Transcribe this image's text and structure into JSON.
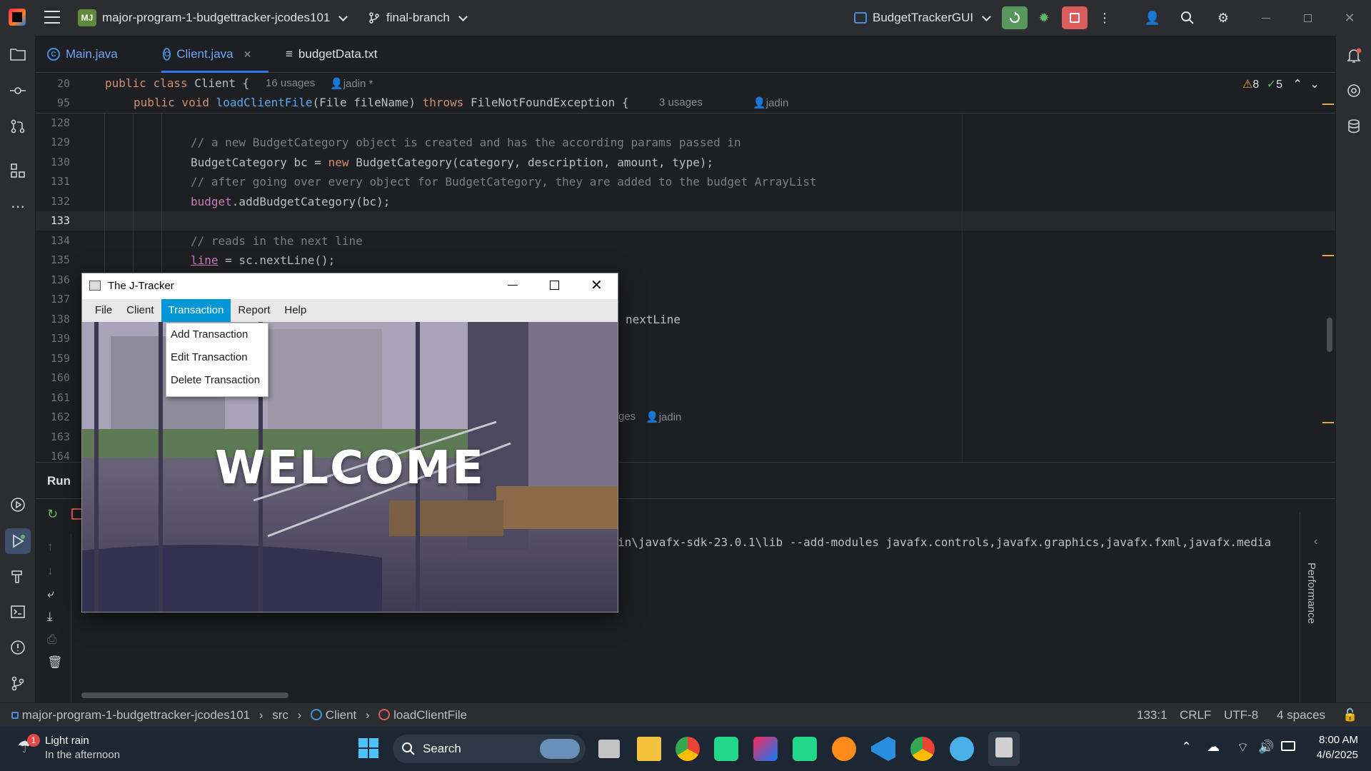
{
  "titlebar": {
    "project_badge": "MJ",
    "project_name": "major-program-1-budgettracker-jcodes101",
    "branch": "final-branch",
    "run_config": "BudgetTrackerGUI"
  },
  "tabs": [
    {
      "label": "Main.java"
    },
    {
      "label": "Client.java"
    },
    {
      "label": "budgetData.txt"
    }
  ],
  "editor": {
    "inspections": {
      "warnings": "8",
      "ok": "5"
    },
    "sticky": [
      {
        "line": "20",
        "pre": "public ",
        "kw2": "class ",
        "name": "Client {",
        "hint": "16 usages",
        "author": "jadin *"
      },
      {
        "line": "95",
        "sig_kw": "public void ",
        "sig_fn": "loadClientFile",
        "sig_args": "(File fileName) ",
        "sig_throws": "throws ",
        "sig_exc": "FileNotFoundException {",
        "hint": "3 usages",
        "author": "jadin"
      }
    ],
    "lines": [
      {
        "n": "128",
        "text": ""
      },
      {
        "n": "129",
        "text": "// a new BudgetCategory object is created and has the according params passed in"
      },
      {
        "n": "130",
        "text": "BudgetCategory bc = new BudgetCategory(category, description, amount, type);"
      },
      {
        "n": "131",
        "text": "// after going over every object for BudgetCategory, they are added to the budget ArrayList"
      },
      {
        "n": "132",
        "text": "budget.addBudgetCategory(bc);"
      },
      {
        "n": "133",
        "text": ""
      },
      {
        "n": "134",
        "text": "// reads in the next line"
      },
      {
        "n": "135",
        "text": "line = sc.nextLine();"
      },
      {
        "n": "136",
        "text": ""
      },
      {
        "n": "137",
        "text": ""
      },
      {
        "n": "138",
        "text": "nextLine"
      },
      {
        "n": "139",
        "text": ""
      },
      {
        "n": "159",
        "text": ""
      },
      {
        "n": "160",
        "text": ""
      },
      {
        "n": "161",
        "text": ""
      },
      {
        "n": "162",
        "text": "ges"
      },
      {
        "n": "163",
        "text": ""
      },
      {
        "n": "164",
        "text": ""
      }
    ],
    "line162_author": "jadin",
    "code130": {
      "type": "BudgetCategory bc = ",
      "kw": "new ",
      "rest": "BudgetCategory(category, description, amount, type);"
    },
    "code132": {
      "field": "budget",
      "rest": ".addBudgetCategory(bc);"
    },
    "code135": {
      "field": "line",
      "rest": " = sc.nextLine();"
    }
  },
  "run_panel": {
    "title": "Run",
    "console_text": "in\\javafx-sdk-23.0.1\\lib --add-modules javafx.controls,javafx.graphics,javafx.fxml,javafx.media",
    "performance_label": "Performance"
  },
  "statusbar": {
    "breadcrumb": [
      "major-program-1-budgettracker-jcodes101",
      "src",
      "Client",
      "loadClientFile"
    ],
    "position": "133:1",
    "line_ending": "CRLF",
    "encoding": "UTF-8",
    "indent": "4 spaces"
  },
  "jtracker": {
    "title": "The J-Tracker",
    "menu": [
      "File",
      "Client",
      "Transaction",
      "Report",
      "Help"
    ],
    "dropdown": [
      "Add Transaction",
      "Edit Transaction",
      "Delete Transaction"
    ],
    "banner_text": "WELCOME"
  },
  "taskbar": {
    "weather_title": "Light rain",
    "weather_sub": "In the afternoon",
    "weather_badge": "1",
    "search_label": "Search",
    "time": "8:00 AM",
    "date": "4/6/2025"
  },
  "colors": {
    "accent": "#3574f0",
    "menu_open": "#0097d6",
    "run_green": "#5fb865",
    "stop_red": "#db5c5c",
    "warning": "#e0a84a"
  }
}
